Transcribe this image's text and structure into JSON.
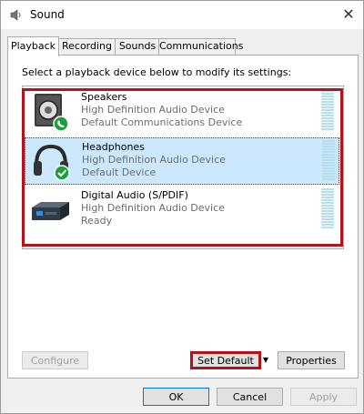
{
  "window": {
    "title": "Sound",
    "close_glyph": "✕"
  },
  "tabs": [
    {
      "label": "Playback",
      "active": true
    },
    {
      "label": "Recording"
    },
    {
      "label": "Sounds"
    },
    {
      "label": "Communications"
    }
  ],
  "instruction": "Select a playback device below to modify its settings:",
  "devices": [
    {
      "name": "Speakers",
      "line1": "High Definition Audio Device",
      "line2": "Default Communications Device",
      "icon": "speaker-icon",
      "badge": "phone-badge-icon"
    },
    {
      "name": "Headphones",
      "line1": "High Definition Audio Device",
      "line2": "Default Device",
      "icon": "headphones-icon",
      "badge": "checkmark-badge-icon",
      "selected": true
    },
    {
      "name": "Digital Audio (S/PDIF)",
      "line1": "High Definition Audio Device",
      "line2": "Ready",
      "icon": "digital-audio-icon"
    }
  ],
  "buttons": {
    "configure": "Configure",
    "set_default": "Set Default",
    "set_default_arrow": "▼",
    "properties": "Properties",
    "ok": "OK",
    "cancel": "Cancel",
    "apply": "Apply"
  },
  "colors": {
    "highlight": "#b0141c",
    "selection": "#cce8ff",
    "badge_green": "#1e9e3c",
    "meter": "#b7dfe9"
  }
}
